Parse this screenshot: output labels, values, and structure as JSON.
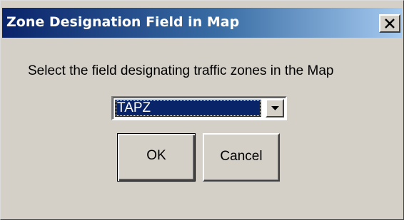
{
  "window": {
    "title": "Zone Designation Field in Map",
    "close_label": "close"
  },
  "prompt": {
    "text": "Select the field designating traffic zones in the Map"
  },
  "field_select": {
    "selected_value": "TAPZ"
  },
  "buttons": {
    "ok_label": "OK",
    "cancel_label": "Cancel"
  },
  "colors": {
    "dialog_face": "#d4d0c8",
    "titlebar_start": "#0a246a",
    "titlebar_end": "#a6caf0",
    "selection": "#0a246a"
  },
  "icons": {
    "close": "close-icon",
    "dropdown": "chevron-down-icon"
  }
}
